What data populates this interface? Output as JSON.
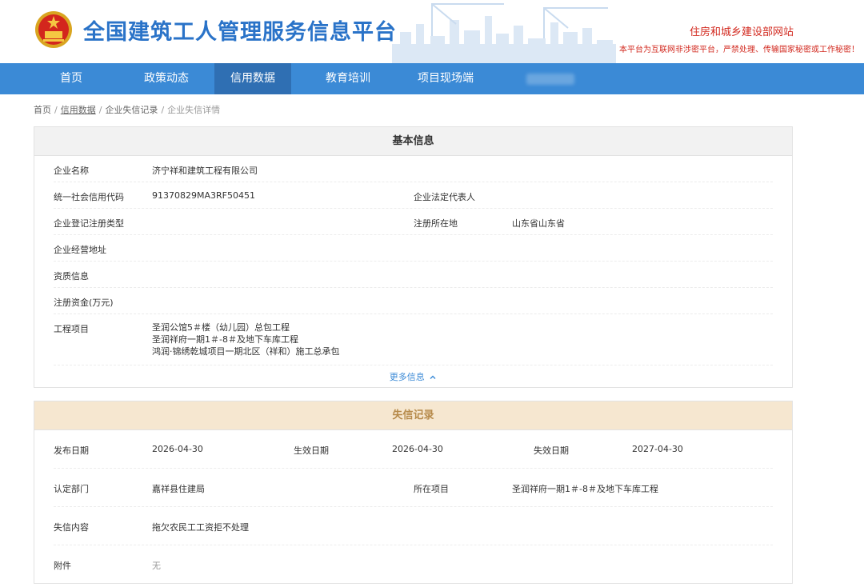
{
  "header": {
    "site_title": "全国建筑工人管理服务信息平台",
    "ministry_link": "住房和城乡建设部网站",
    "warning": "本平台为互联网非涉密平台，严禁处理、传输国家秘密或工作秘密！"
  },
  "nav": {
    "items": [
      {
        "label": "首页"
      },
      {
        "label": "政策动态"
      },
      {
        "label": "信用数据"
      },
      {
        "label": "教育培训"
      },
      {
        "label": "项目现场端"
      }
    ],
    "active_index": 2
  },
  "breadcrumb": [
    "首页",
    "信用数据",
    "企业失信记录",
    "企业失信详情"
  ],
  "basic": {
    "title": "基本信息",
    "company_name_label": "企业名称",
    "company_name": "济宁祥和建筑工程有限公司",
    "credit_code_label": "统一社会信用代码",
    "credit_code": "91370829MA3RF50451",
    "legal_rep_label": "企业法定代表人",
    "legal_rep": "",
    "reg_type_label": "企业登记注册类型",
    "reg_type": "",
    "reg_place_label": "注册所在地",
    "reg_place": "山东省山东省",
    "address_label": "企业经营地址",
    "address": "",
    "qualification_label": "资质信息",
    "qualification": "",
    "capital_label": "注册资金(万元)",
    "capital": "",
    "projects_label": "工程项目",
    "projects": [
      "圣润公馆5＃楼（幼儿园）总包工程",
      "圣润祥府一期1＃-8＃及地下车库工程",
      "鸿润·锦绣乾城项目一期北区（祥和）施工总承包"
    ],
    "more": "更多信息"
  },
  "credit": {
    "title": "失信记录",
    "publish_date_label": "发布日期",
    "publish_date": "2026-04-30",
    "effective_date_label": "生效日期",
    "effective_date": "2026-04-30",
    "expire_date_label": "失效日期",
    "expire_date": "2027-04-30",
    "department_label": "认定部门",
    "department": "嘉祥县住建局",
    "project_label": "所在项目",
    "project": "圣润祥府一期1＃-8＃及地下车库工程",
    "content_label": "失信内容",
    "content": "拖欠农民工工资拒不处理",
    "attachment_label": "附件",
    "attachment": "无"
  },
  "colors": {
    "brand_blue": "#2a73c8",
    "nav_blue": "#3b8ad6",
    "nav_active": "#2f6fb3",
    "warning_red": "#d2281e",
    "credit_head_bg": "#f6e7d0",
    "credit_head_text": "#b68a4a"
  }
}
